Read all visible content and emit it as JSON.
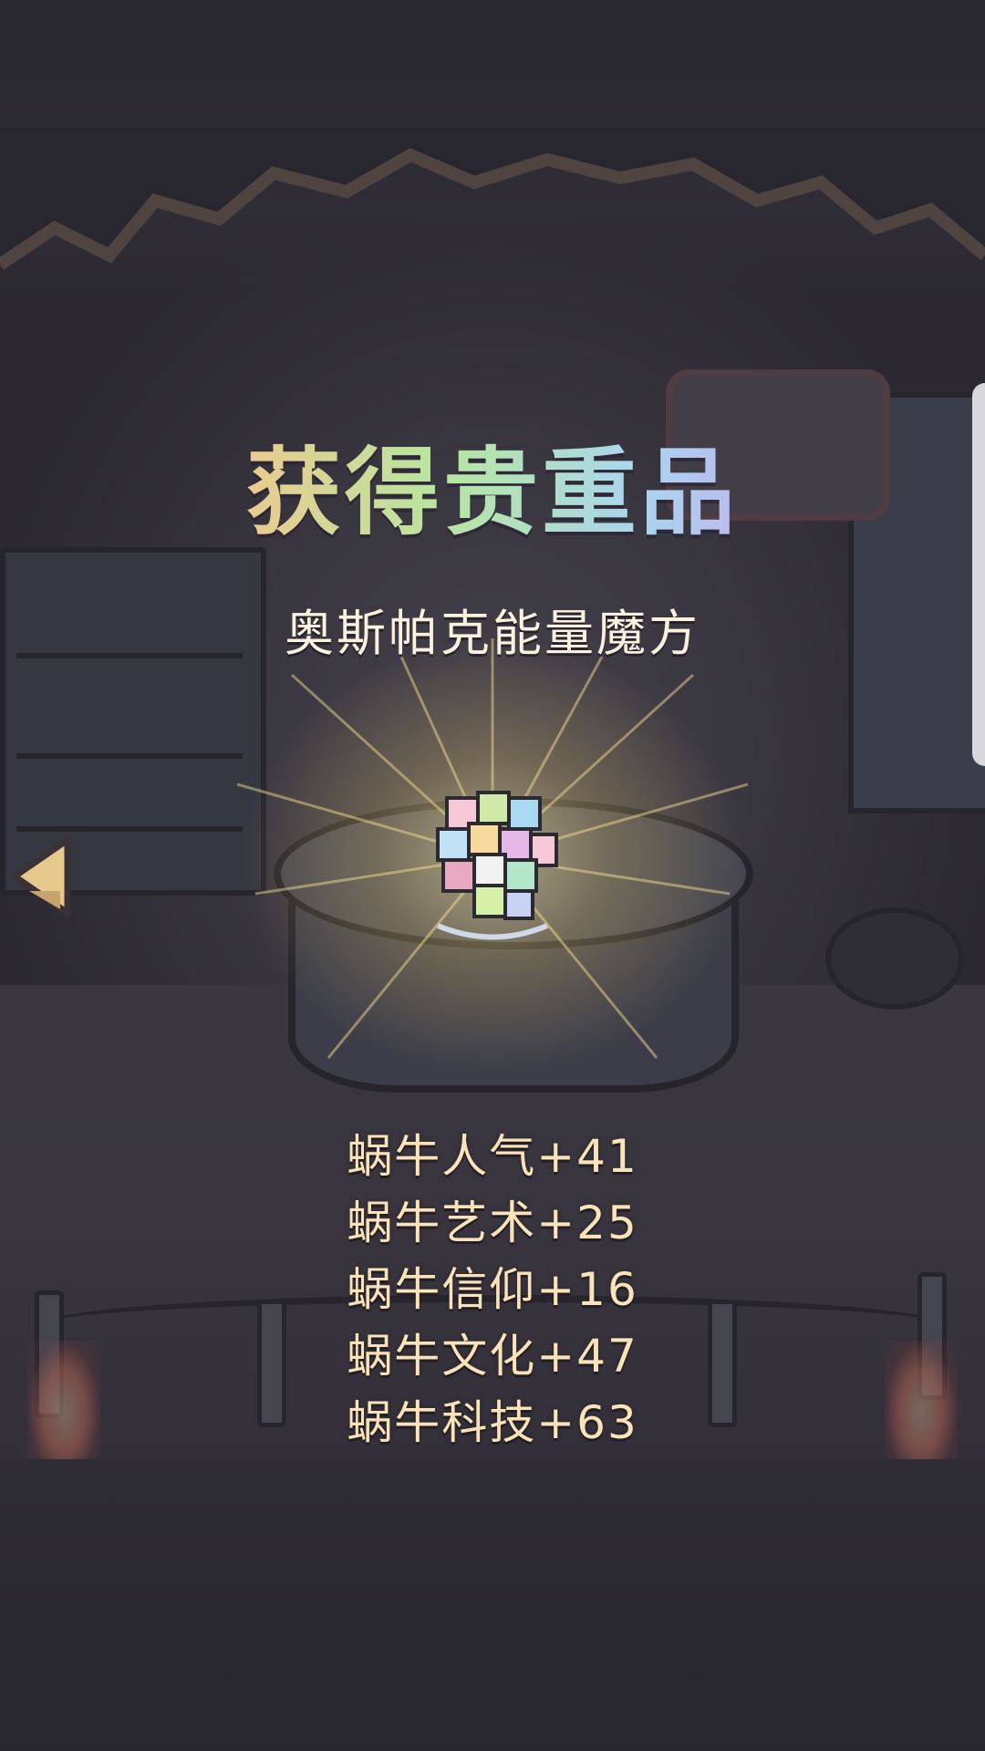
{
  "popup": {
    "title": "获得贵重品",
    "item_name": "奥斯帕克能量魔方",
    "stats": [
      "蜗牛人气+41",
      "蜗牛艺术+25",
      "蜗牛信仰+16",
      "蜗牛文化+47",
      "蜗牛科技+63"
    ]
  },
  "icons": {
    "back": "left-arrow-icon",
    "item": "rainbow-cube-icon"
  },
  "colors": {
    "stat_text": "#fbe3b8",
    "item_name_text": "#fbf1df",
    "title_gradient": [
      "#f3a6b8",
      "#f2c78c",
      "#b7e6a0",
      "#a9d6ef",
      "#c8a8ee"
    ]
  }
}
